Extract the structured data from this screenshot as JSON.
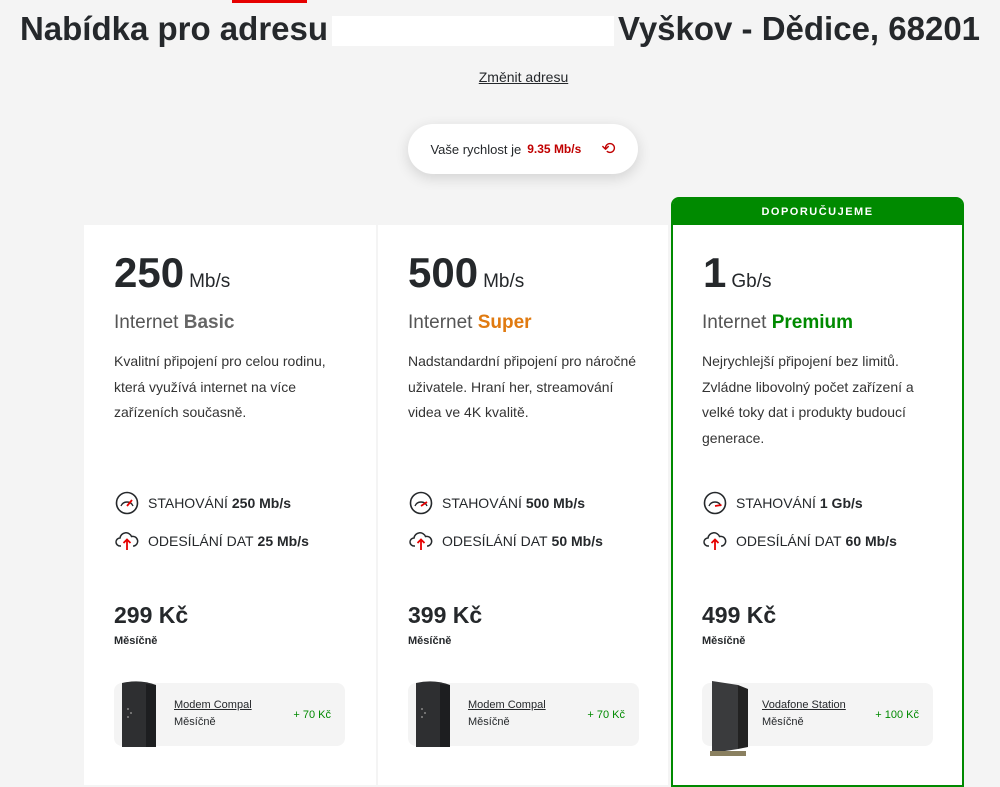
{
  "header": {
    "title_prefix": "Nabídka pro adresu",
    "title_suffix": "Vyškov - Dědice, 68201",
    "change_address": "Změnit adresu"
  },
  "speed_check": {
    "label": "Vaše rychlost je",
    "value": "9.35 Mb/s"
  },
  "plans": [
    {
      "speed": "250",
      "unit": "Mb/s",
      "product_prefix": "Internet",
      "product_name": "Basic",
      "description": "Kvalitní připojení pro celou rodinu, která využívá internet na více zařízeních současně.",
      "download_label": "STAHOVÁNÍ",
      "download_value": "250 Mb/s",
      "upload_label": "ODESÍLÁNÍ DAT",
      "upload_value": "25 Mb/s",
      "price": "299 Kč",
      "period": "Měsíčně",
      "device_name": "Modem Compal",
      "device_period": "Měsíčně",
      "device_price": "+ 70 Kč"
    },
    {
      "speed": "500",
      "unit": "Mb/s",
      "product_prefix": "Internet",
      "product_name": "Super",
      "description": "Nadstandardní připojení pro náročné uživatele. Hraní her, streamování videa ve 4K kvalitě.",
      "download_label": "STAHOVÁNÍ",
      "download_value": "500 Mb/s",
      "upload_label": "ODESÍLÁNÍ DAT",
      "upload_value": "50 Mb/s",
      "price": "399 Kč",
      "period": "Měsíčně",
      "device_name": "Modem Compal",
      "device_period": "Měsíčně",
      "device_price": "+ 70 Kč"
    },
    {
      "badge": "DOPORUČUJEME",
      "speed": "1",
      "unit": "Gb/s",
      "product_prefix": "Internet",
      "product_name": "Premium",
      "description": "Nejrychlejší připojení bez limitů. Zvládne libovolný počet zařízení a velké toky dat i produkty budoucí generace.",
      "download_label": "STAHOVÁNÍ",
      "download_value": "1 Gb/s",
      "upload_label": "ODESÍLÁNÍ DAT",
      "upload_value": "60 Mb/s",
      "price": "499 Kč",
      "period": "Měsíčně",
      "device_name": "Vodafone Station",
      "device_period": "Měsíčně",
      "device_price": "+ 100 Kč"
    }
  ],
  "icons": {
    "download": "speedometer-icon",
    "upload": "cloud-upload-icon",
    "refresh": "refresh-icon"
  },
  "colors": {
    "brand_red": "#e60000",
    "recommended_green": "#008a00",
    "super_orange": "#e07a10"
  }
}
